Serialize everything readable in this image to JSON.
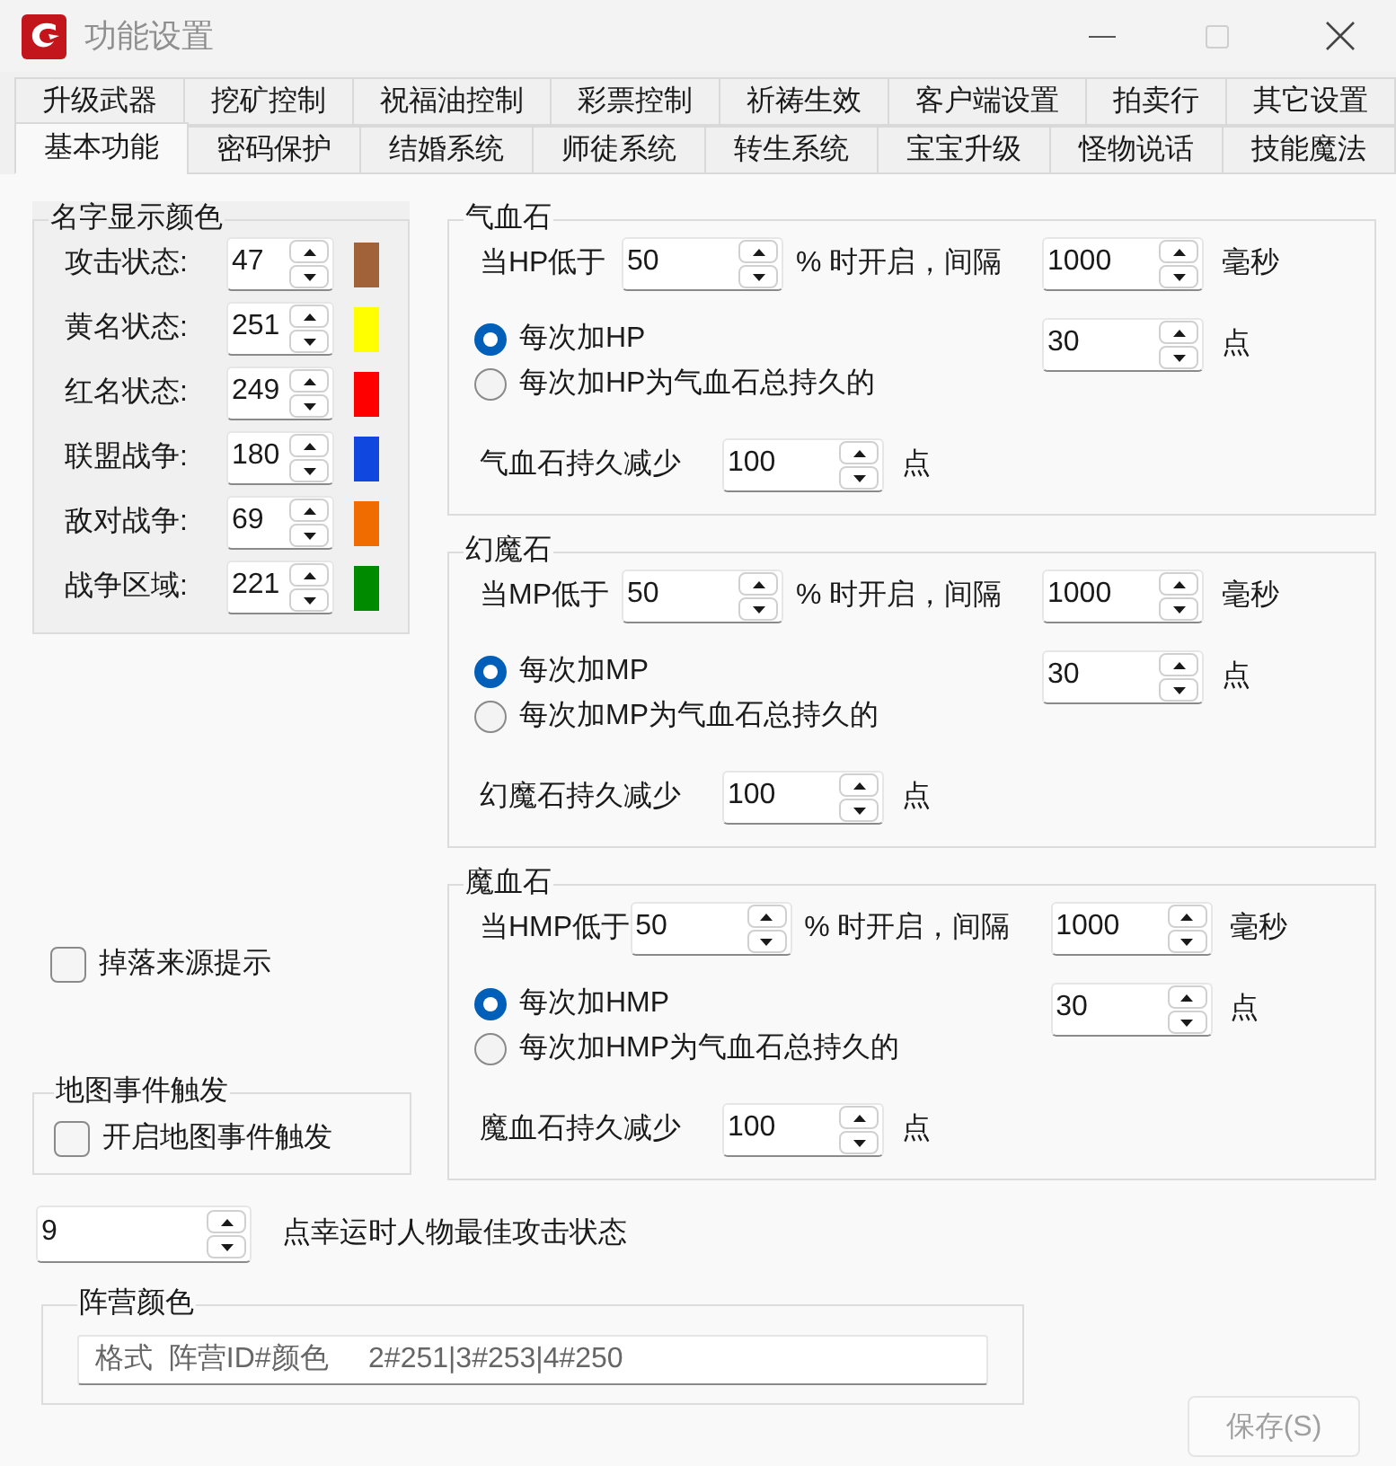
{
  "window": {
    "title": "功能设置"
  },
  "tab_rows": [
    {
      "tabs": [
        {
          "label": "升级武器",
          "selected": false
        },
        {
          "label": "挖矿控制",
          "selected": false
        },
        {
          "label": "祝福油控制",
          "selected": false
        },
        {
          "label": "彩票控制",
          "selected": false
        },
        {
          "label": "祈祷生效",
          "selected": false
        },
        {
          "label": "客户端设置",
          "selected": false
        },
        {
          "label": "拍卖行",
          "selected": false
        },
        {
          "label": "其它设置",
          "selected": false
        }
      ]
    },
    {
      "tabs": [
        {
          "label": "基本功能",
          "selected": true
        },
        {
          "label": "密码保护",
          "selected": false
        },
        {
          "label": "结婚系统",
          "selected": false
        },
        {
          "label": "师徒系统",
          "selected": false
        },
        {
          "label": "转生系统",
          "selected": false
        },
        {
          "label": "宝宝升级",
          "selected": false
        },
        {
          "label": "怪物说话",
          "selected": false
        },
        {
          "label": "技能魔法",
          "selected": false
        }
      ]
    }
  ],
  "name_colors": {
    "title": "名字显示颜色",
    "rows": [
      {
        "label": "攻击状态:",
        "value": "47",
        "color": "#a26239"
      },
      {
        "label": "黄名状态:",
        "value": "251",
        "color": "#ffff00"
      },
      {
        "label": "红名状态:",
        "value": "249",
        "color": "#ff0000"
      },
      {
        "label": "联盟战争:",
        "value": "180",
        "color": "#0f47df"
      },
      {
        "label": "敌对战争:",
        "value": "69",
        "color": "#f06c00"
      },
      {
        "label": "战争区域:",
        "value": "221",
        "color": "#008a00"
      }
    ]
  },
  "stones": [
    {
      "title": "气血石",
      "threshold_label": "当HP低于",
      "threshold": "50",
      "interval_label": "% 时开启，间隔",
      "interval": "1000",
      "interval_unit": "毫秒",
      "options": [
        {
          "label": "每次加HP",
          "selected": true
        },
        {
          "label": "每次加HP为气血石总持久的",
          "selected": false
        }
      ],
      "amount": "30",
      "amount_unit": "点",
      "decrease_label": "气血石持久减少",
      "decrease": "100",
      "decrease_unit": "点"
    },
    {
      "title": "幻魔石",
      "threshold_label": "当MP低于",
      "threshold": "50",
      "interval_label": "% 时开启，间隔",
      "interval": "1000",
      "interval_unit": "毫秒",
      "options": [
        {
          "label": "每次加MP",
          "selected": true
        },
        {
          "label": "每次加MP为气血石总持久的",
          "selected": false
        }
      ],
      "amount": "30",
      "amount_unit": "点",
      "decrease_label": "幻魔石持久减少",
      "decrease": "100",
      "decrease_unit": "点"
    },
    {
      "title": "魔血石",
      "threshold_label": "当HMP低于",
      "threshold": "50",
      "interval_label": "% 时开启，间隔",
      "interval": "1000",
      "interval_unit": "毫秒",
      "options": [
        {
          "label": "每次加HMP",
          "selected": true
        },
        {
          "label": "每次加HMP为气血石总持久的",
          "selected": false
        }
      ],
      "amount": "30",
      "amount_unit": "点",
      "decrease_label": "魔血石持久减少",
      "decrease": "100",
      "decrease_unit": "点"
    }
  ],
  "drop_source_hint": {
    "label": "掉落来源提示",
    "checked": false
  },
  "map_events": {
    "title": "地图事件触发",
    "checkbox": {
      "label": "开启地图事件触发",
      "checked": false
    }
  },
  "lucky": {
    "value": "9",
    "label": "点幸运时人物最佳攻击状态"
  },
  "camp_colors": {
    "title": "阵营颜色",
    "input": {
      "placeholder": "格式  阵营ID#颜色     2#251|3#253|4#250"
    }
  },
  "save_button": {
    "label": "保存(S)",
    "disabled": true
  }
}
